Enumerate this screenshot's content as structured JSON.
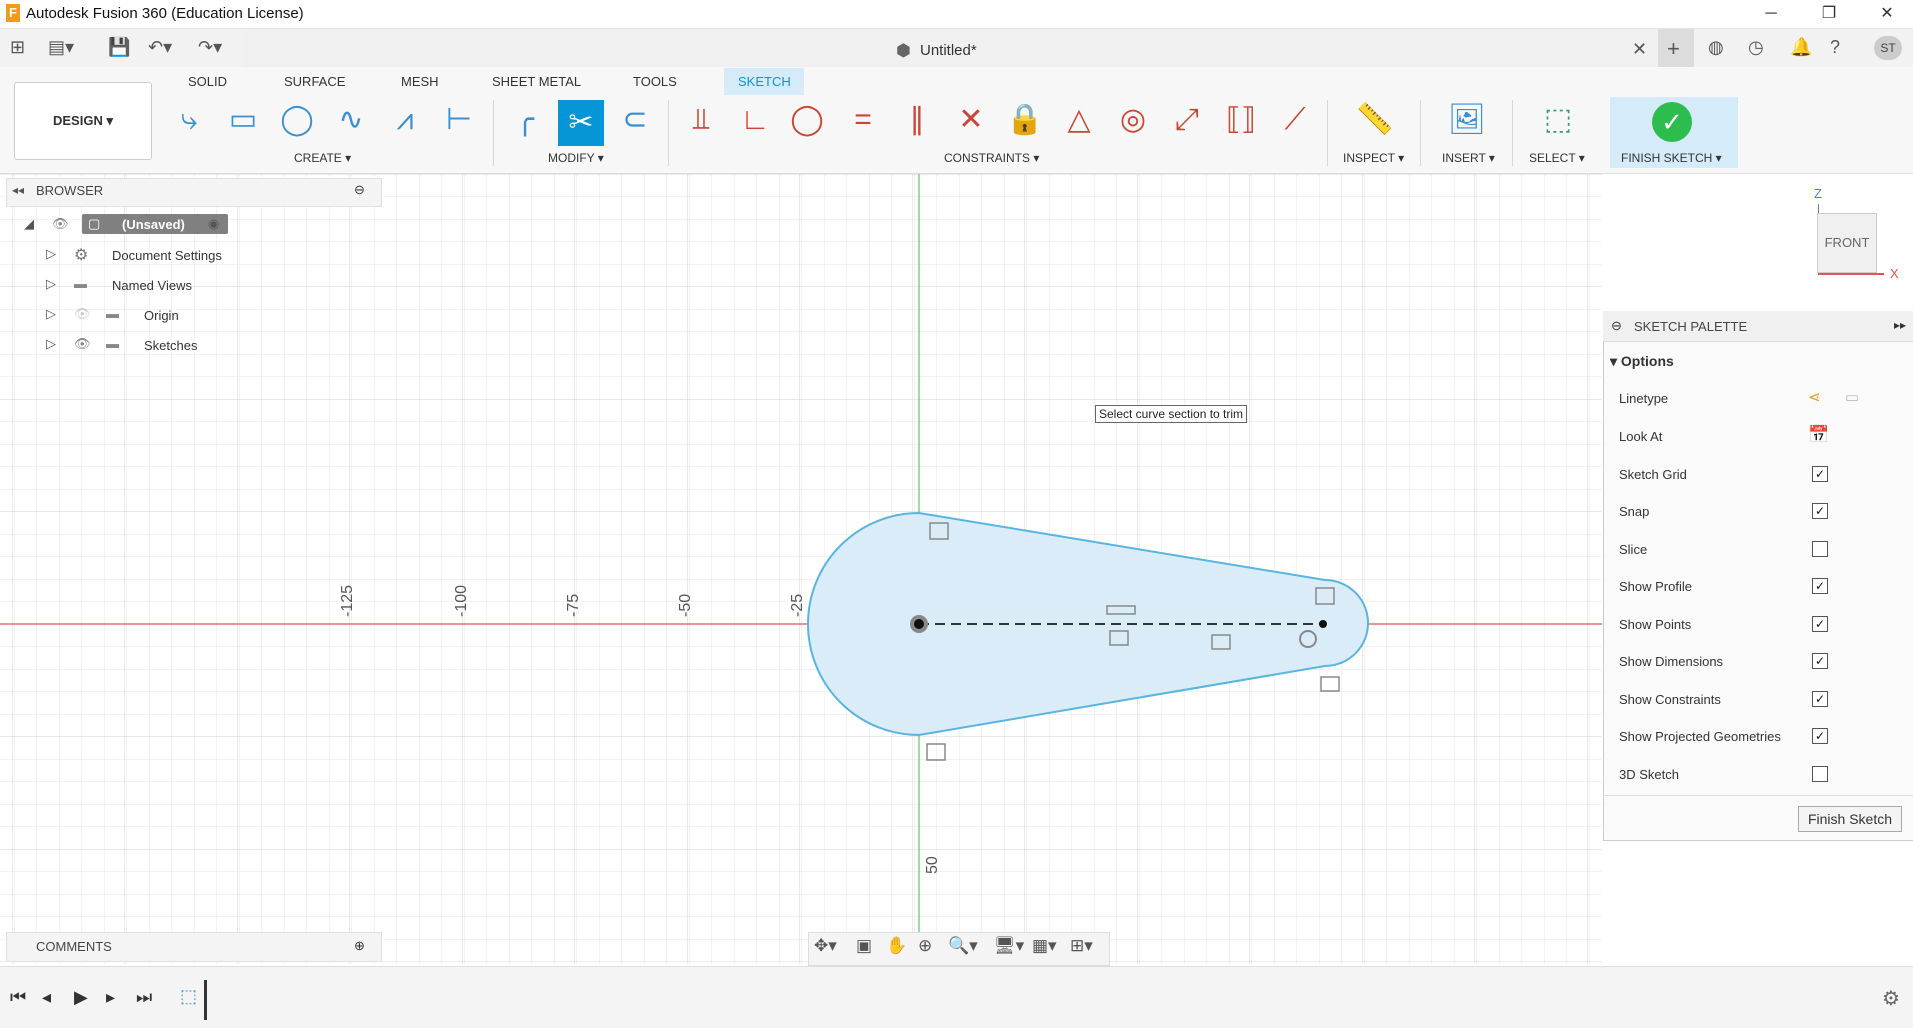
{
  "app": {
    "title": "Autodesk Fusion 360 (Education License)",
    "icon_letter": "F"
  },
  "window_controls": {
    "minimize": "─",
    "restore": "❐",
    "close": "✕"
  },
  "document": {
    "title": "Untitled*"
  },
  "ribbon": {
    "workspace": "DESIGN ▾",
    "tabs": [
      "SOLID",
      "SURFACE",
      "MESH",
      "SHEET METAL",
      "TOOLS",
      "SKETCH"
    ],
    "active_tab": "SKETCH",
    "groups": [
      "CREATE ▾",
      "MODIFY ▾",
      "CONSTRAINTS ▾",
      "INSPECT ▾",
      "INSERT ▾",
      "SELECT ▾",
      "FINISH SKETCH ▾"
    ]
  },
  "browser": {
    "title": "BROWSER",
    "items": [
      {
        "label": "(Unsaved)",
        "icon": "document-icon"
      },
      {
        "label": "Document Settings",
        "icon": "gear-icon"
      },
      {
        "label": "Named Views",
        "icon": "folder-icon"
      },
      {
        "label": "Origin",
        "icon": "folder-icon"
      },
      {
        "label": "Sketches",
        "icon": "folder-icon"
      }
    ]
  },
  "canvas": {
    "tooltip": "Select curve section to trim",
    "ruler_labels": [
      "-125",
      "-100",
      "-75",
      "-50",
      "-25",
      "50"
    ],
    "viewcube": {
      "face": "FRONT",
      "axis_z": "Z",
      "axis_x": "X"
    }
  },
  "sketch_palette": {
    "title": "SKETCH PALETTE",
    "section": "Options",
    "options": [
      {
        "label": "Linetype",
        "type": "icons"
      },
      {
        "label": "Look At",
        "type": "icon"
      },
      {
        "label": "Sketch Grid",
        "checked": true
      },
      {
        "label": "Snap",
        "checked": true
      },
      {
        "label": "Slice",
        "checked": false
      },
      {
        "label": "Show Profile",
        "checked": true
      },
      {
        "label": "Show Points",
        "checked": true
      },
      {
        "label": "Show Dimensions",
        "checked": true
      },
      {
        "label": "Show Constraints",
        "checked": true
      },
      {
        "label": "Show Projected Geometries",
        "checked": true
      },
      {
        "label": "3D Sketch",
        "checked": false
      }
    ],
    "finish_button": "Finish Sketch"
  },
  "comments": {
    "title": "COMMENTS"
  },
  "colors": {
    "accent": "#0696d7",
    "sketch_fill": "#d9ecf7",
    "sketch_line": "#5ab4e0",
    "x_axis": "#e05555",
    "y_axis": "#5ac85a",
    "finish_green": "#2dbd4e"
  }
}
